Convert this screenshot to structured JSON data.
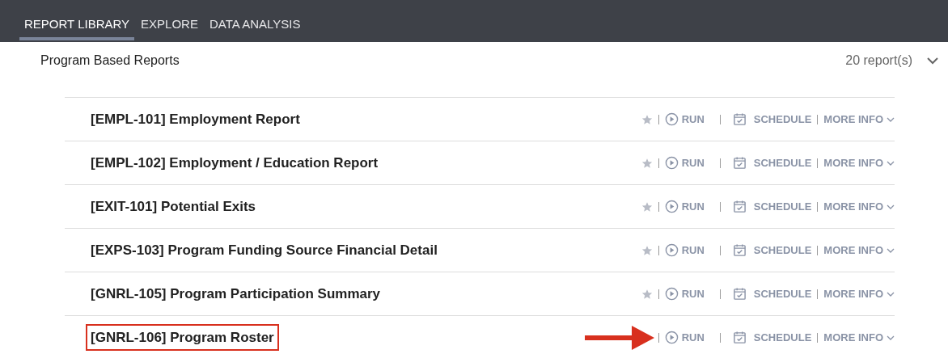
{
  "tabs": [
    {
      "label": "REPORT LIBRARY",
      "selected": true
    },
    {
      "label": "EXPLORE",
      "selected": false
    },
    {
      "label": "DATA ANALYSIS",
      "selected": false
    }
  ],
  "section": {
    "title": "Program Based Reports",
    "count": "20 report(s)",
    "expanded": true
  },
  "reports": [
    {
      "title": "[EMPL-101] Employment Report",
      "highlighted": false,
      "run": "RUN",
      "schedule": "SCHEDULE",
      "more_info": "MORE INFO"
    },
    {
      "title": "[EMPL-102] Employment / Education Report",
      "highlighted": false,
      "run": "RUN",
      "schedule": "SCHEDULE",
      "more_info": "MORE INFO"
    },
    {
      "title": "[EXIT-101] Potential Exits",
      "highlighted": false,
      "run": "RUN",
      "schedule": "SCHEDULE",
      "more_info": "MORE INFO"
    },
    {
      "title": "[EXPS-103] Program Funding Source Financial Detail",
      "highlighted": false,
      "run": "RUN",
      "schedule": "SCHEDULE",
      "more_info": "MORE INFO"
    },
    {
      "title": "[GNRL-105] Program Participation Summary",
      "highlighted": false,
      "run": "RUN",
      "schedule": "SCHEDULE",
      "more_info": "MORE INFO"
    },
    {
      "title": "[GNRL-106] Program Roster",
      "highlighted": true,
      "run": "RUN",
      "schedule": "SCHEDULE",
      "more_info": "MORE INFO"
    }
  ]
}
